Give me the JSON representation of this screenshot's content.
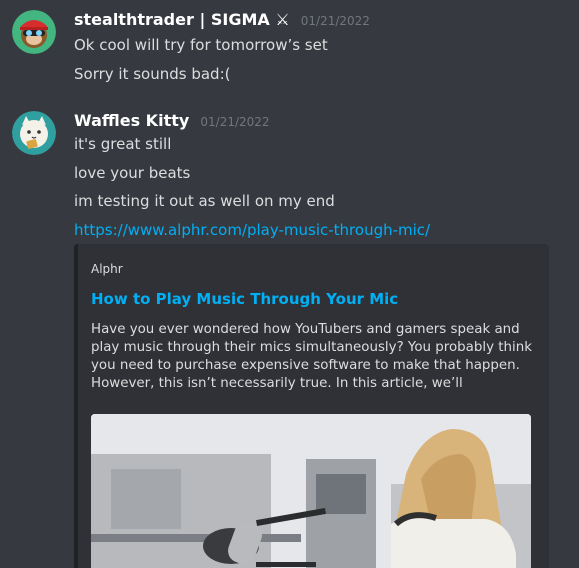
{
  "messages": [
    {
      "username": "stealthtrader | SIGMA ⚔",
      "timestamp": "01/21/2022",
      "lines": [
        "Ok cool will try for tomorrow’s set",
        "Sorry it sounds bad:("
      ]
    },
    {
      "username": "Waffles Kitty",
      "timestamp": "01/21/2022",
      "lines": [
        "it's great still",
        "love your beats",
        "im testing it out as well on my end"
      ],
      "link": "https://www.alphr.com/play-music-through-mic/",
      "embed": {
        "provider": "Alphr",
        "title": "How to Play Music Through Your Mic",
        "description": "Have you ever wondered how YouTubers and gamers speak and play music through their mics simultaneously? You probably think you need to purchase expensive software to make that happen. However, this isn’t necessarily true. In this article, we’ll"
      }
    }
  ],
  "colors": {
    "background": "#36393f",
    "embed_background": "#2f3136",
    "link": "#00aff4",
    "username": "#ffffff",
    "timestamp": "#72767d",
    "text": "#dcddde"
  }
}
